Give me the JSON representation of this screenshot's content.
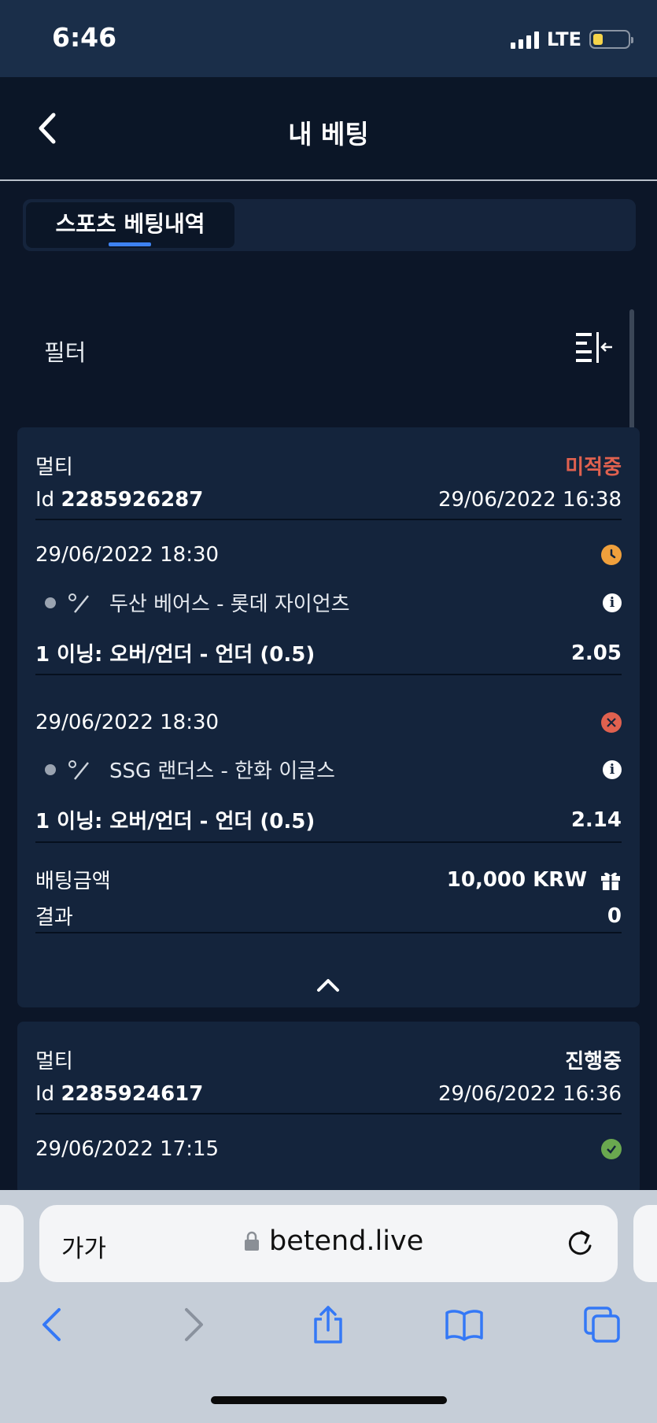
{
  "status_bar": {
    "time": "6:46",
    "network": "LTE"
  },
  "header": {
    "title": "내 베팅"
  },
  "tabs": [
    {
      "label": "스포츠 베팅내역"
    }
  ],
  "filter": {
    "label": "필터"
  },
  "bets": [
    {
      "type": "멀티",
      "status": "미적중",
      "id_label": "Id",
      "id": "2285926287",
      "placed_at": "29/06/2022 16:38",
      "selections": [
        {
          "datetime": "29/06/2022 18:30",
          "state": "pending-clock",
          "match": "두산 베어스 - 롯데 자이언츠",
          "market": "1 이닝: 오버/언더 - 언더 (0.5)",
          "odds": "2.05"
        },
        {
          "datetime": "29/06/2022 18:30",
          "state": "lost",
          "match": "SSG 랜더스 - 한화 이글스",
          "market": "1 이닝: 오버/언더 - 언더 (0.5)",
          "odds": "2.14"
        }
      ],
      "stake_label": "배팅금액",
      "stake": "10,000 KRW",
      "result_label": "결과",
      "result": "0"
    },
    {
      "type": "멀티",
      "status": "진행중",
      "id_label": "Id",
      "id": "2285924617",
      "placed_at": "29/06/2022 16:36",
      "selections": [
        {
          "datetime": "29/06/2022 17:15",
          "state": "won"
        }
      ]
    }
  ],
  "browser": {
    "text_size_label": "가가",
    "url": "betend.live"
  },
  "colors": {
    "background": "#0c1628",
    "card": "#14243c",
    "lost": "#e0614f",
    "pending": "#f0a03c",
    "won": "#6aa84f",
    "accent": "#3d82f2"
  }
}
